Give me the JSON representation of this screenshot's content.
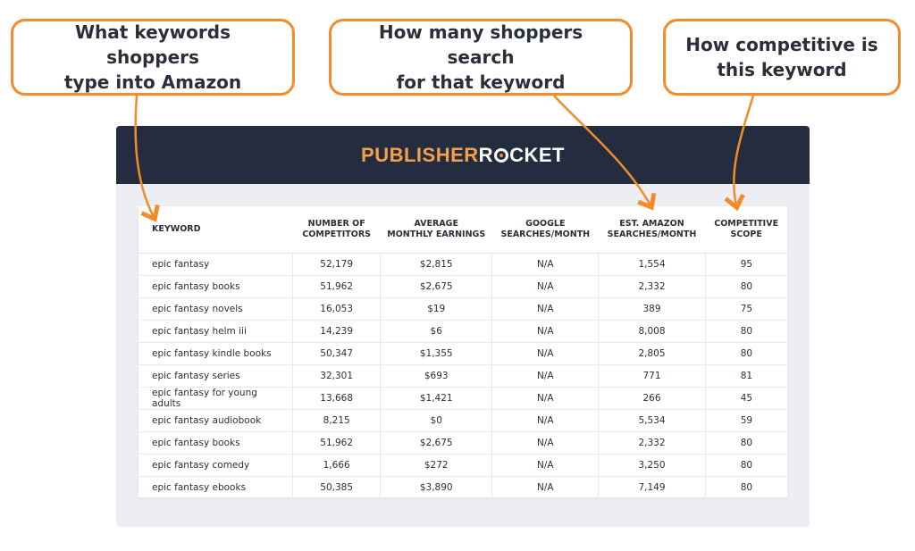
{
  "callouts": [
    {
      "text": "What keywords shoppers\ntype into Amazon"
    },
    {
      "text": "How many shoppers search\nfor that keyword"
    },
    {
      "text": "How competitive is\nthis keyword"
    }
  ],
  "logo": {
    "part1": "PUBLISHER",
    "part2a": "R",
    "part2b": "CKET"
  },
  "colors": {
    "accent": "#f28c28",
    "header_bg": "#232d3f",
    "panel_bg": "#eceef3"
  },
  "table": {
    "headers": [
      "KEYWORD",
      "NUMBER OF\nCOMPETITORS",
      "AVERAGE\nMONTHLY EARNINGS",
      "GOOGLE\nSEARCHES/MONTH",
      "EST. AMAZON\nSEARCHES/MONTH",
      "COMPETITIVE\nSCOPE"
    ],
    "rows": [
      [
        "epic fantasy",
        "52,179",
        "$2,815",
        "N/A",
        "1,554",
        "95"
      ],
      [
        "epic fantasy books",
        "51,962",
        "$2,675",
        "N/A",
        "2,332",
        "80"
      ],
      [
        "epic fantasy novels",
        "16,053",
        "$19",
        "N/A",
        "389",
        "75"
      ],
      [
        "epic fantasy helm iii",
        "14,239",
        "$6",
        "N/A",
        "8,008",
        "80"
      ],
      [
        "epic fantasy kindle books",
        "50,347",
        "$1,355",
        "N/A",
        "2,805",
        "80"
      ],
      [
        "epic fantasy series",
        "32,301",
        "$693",
        "N/A",
        "771",
        "81"
      ],
      [
        "epic fantasy for young adults",
        "13,668",
        "$1,421",
        "N/A",
        "266",
        "45"
      ],
      [
        "epic fantasy audiobook",
        "8,215",
        "$0",
        "N/A",
        "5,534",
        "59"
      ],
      [
        "epic fantasy books",
        "51,962",
        "$2,675",
        "N/A",
        "2,332",
        "80"
      ],
      [
        "epic fantasy comedy",
        "1,666",
        "$272",
        "N/A",
        "3,250",
        "80"
      ],
      [
        "epic fantasy ebooks",
        "50,385",
        "$3,890",
        "N/A",
        "7,149",
        "80"
      ]
    ]
  }
}
